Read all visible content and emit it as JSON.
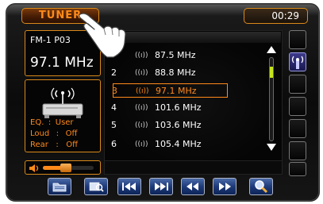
{
  "header": {
    "tab_label": "TUNER",
    "clock": "00:29"
  },
  "freq_panel": {
    "band_preset": "FM-1 P03",
    "current_frequency": "97.1 MHz"
  },
  "status": {
    "eq_label": "EQ.",
    "eq_value": "User",
    "loud_label": "Loud",
    "loud_value": "Off",
    "rear_label": "Rear",
    "rear_value": "Off"
  },
  "volume": {
    "level": 0.45
  },
  "stations": [
    {
      "num": "",
      "freq": "87.5 MHz"
    },
    {
      "num": "2",
      "freq": "88.8 MHz"
    },
    {
      "num": "3",
      "freq": "97.1 MHz",
      "selected": true
    },
    {
      "num": "4",
      "freq": "101.6 MHz"
    },
    {
      "num": "5",
      "freq": "103.6 MHz"
    },
    {
      "num": "6",
      "freq": "105.4 MHz"
    }
  ],
  "controls": [
    {
      "icon": "folder-icon"
    },
    {
      "icon": "search-list-icon"
    },
    {
      "icon": "skip-previous-icon"
    },
    {
      "icon": "skip-next-icon"
    },
    {
      "icon": "rewind-icon"
    },
    {
      "icon": "fast-forward-icon"
    },
    {
      "icon": "magnifier-icon"
    }
  ],
  "colors": {
    "accent": "#ff8a1a",
    "scroll_indicator": "#c6e41a",
    "button_blue": "#1e3a7a"
  },
  "scroll_position": 0.12
}
